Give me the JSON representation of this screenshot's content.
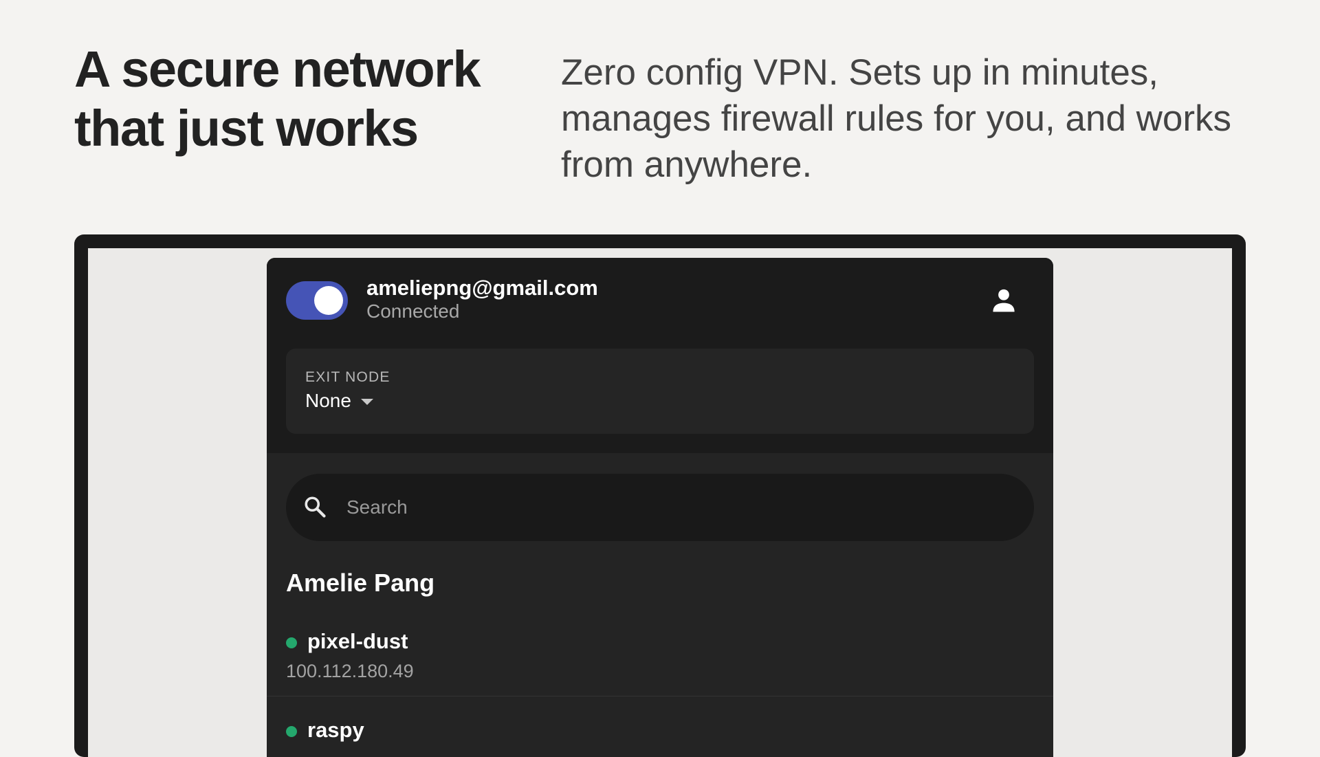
{
  "hero": {
    "title": "A secure network that just works",
    "description": "Zero config VPN. Sets up in minutes, manages firewall rules for you, and works from anywhere."
  },
  "app": {
    "account": {
      "email": "ameliepng@gmail.com",
      "status": "Connected",
      "connected": true
    },
    "exit_node": {
      "label": "EXIT NODE",
      "value": "None"
    },
    "search": {
      "placeholder": "Search",
      "value": ""
    },
    "owner": {
      "name": "Amelie Pang"
    },
    "devices": [
      {
        "name": "pixel-dust",
        "ip": "100.112.180.49",
        "online": true
      },
      {
        "name": "raspy",
        "ip": "",
        "online": true
      }
    ],
    "colors": {
      "accent": "#4554b6",
      "online": "#24a86d",
      "panel": "#242424",
      "header": "#1b1b1b"
    },
    "icons": {
      "profile": "person-icon",
      "search": "search-icon",
      "dropdown": "caret-down-icon"
    }
  }
}
